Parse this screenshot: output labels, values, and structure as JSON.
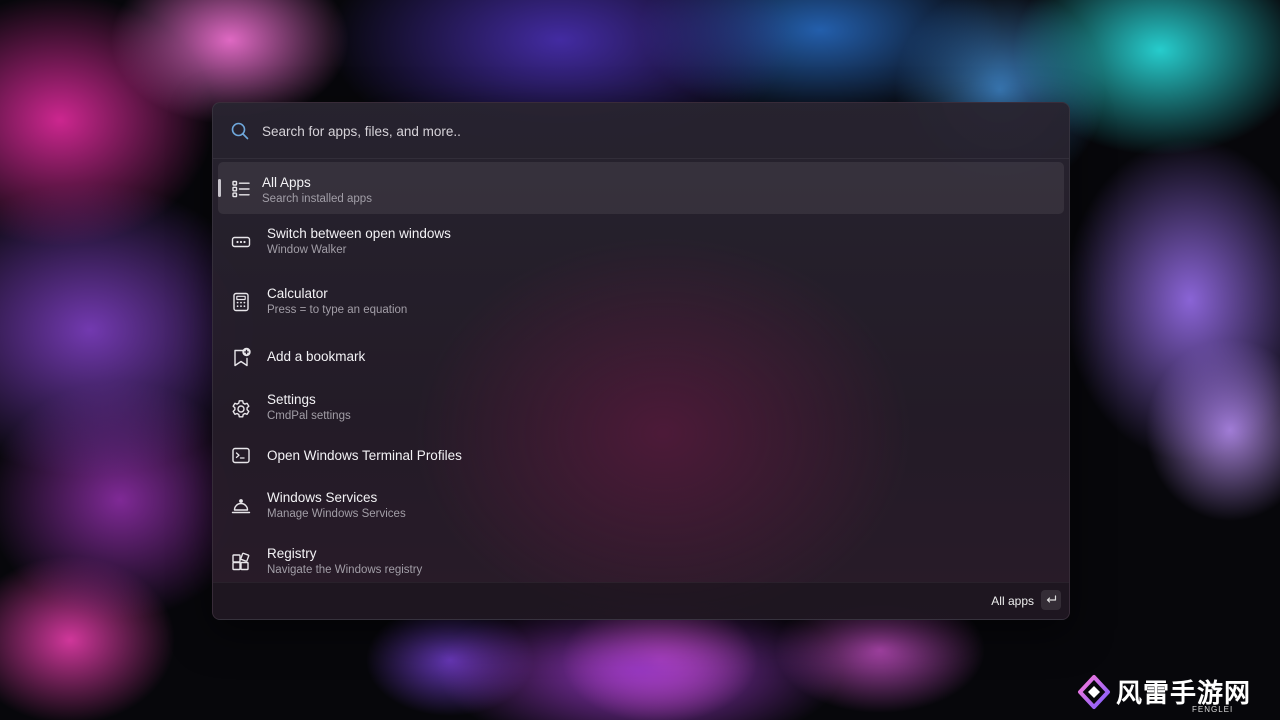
{
  "search": {
    "placeholder": "Search for apps, files, and more..",
    "value": ""
  },
  "items": [
    {
      "title": "All Apps",
      "subtitle": "Search installed apps",
      "icon": "list-icon",
      "selected": true
    },
    {
      "title": "Switch between open windows",
      "subtitle": "Window Walker",
      "icon": "window-walker-icon"
    },
    {
      "title": "Calculator",
      "subtitle": "Press = to type an equation",
      "icon": "calculator-icon"
    },
    {
      "title": "Add a bookmark",
      "subtitle": "",
      "icon": "bookmark-add-icon"
    },
    {
      "title": "Settings",
      "subtitle": "CmdPal settings",
      "icon": "gear-icon"
    },
    {
      "title": "Open Windows Terminal Profiles",
      "subtitle": "",
      "icon": "terminal-icon"
    },
    {
      "title": "Windows Services",
      "subtitle": "Manage Windows Services",
      "icon": "services-icon"
    },
    {
      "title": "Registry",
      "subtitle": "Navigate the Windows registry",
      "icon": "registry-icon"
    }
  ],
  "footer": {
    "primary_action": "All apps",
    "key_icon": "enter-key-icon"
  },
  "watermark": {
    "text_cn": "风雷手游网",
    "text_en": "FENGLEI"
  },
  "colors": {
    "accent": "#ffffff",
    "subtitle": "#a29ea7",
    "selection": "rgba(255,255,255,0.075)"
  }
}
